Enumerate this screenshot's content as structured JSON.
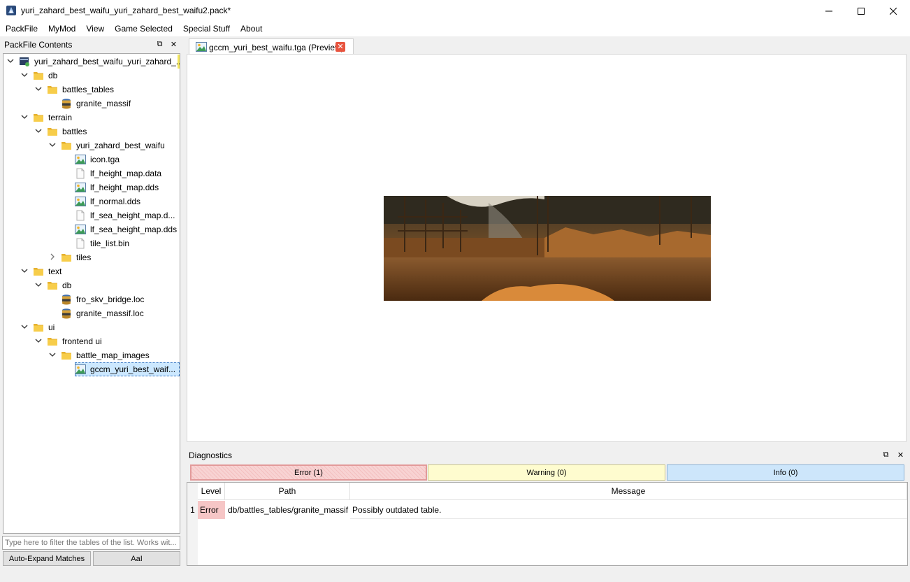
{
  "window": {
    "title": "yuri_zahard_best_waifu_yuri_zahard_best_waifu2.pack*",
    "minimize_glyph": "—",
    "maximize_glyph": "☐",
    "close_glyph": "✕"
  },
  "menu": [
    "PackFile",
    "MyMod",
    "View",
    "Game Selected",
    "Special Stuff",
    "About"
  ],
  "left_panel": {
    "title": "PackFile Contents",
    "float_glyph": "⧉",
    "close_glyph": "✕",
    "tree": [
      {
        "label": "yuri_zahard_best_waifu_yuri_zahard_...",
        "icon": "pack-icon",
        "expanded": true
      },
      {
        "label": "db",
        "icon": "folder-icon",
        "expanded": true
      },
      {
        "label": "battles_tables",
        "icon": "folder-icon",
        "expanded": true
      },
      {
        "label": "granite_massif",
        "icon": "database-icon"
      },
      {
        "label": "terrain",
        "icon": "folder-icon",
        "expanded": true
      },
      {
        "label": "battles",
        "icon": "folder-icon",
        "expanded": true
      },
      {
        "label": "yuri_zahard_best_waifu",
        "icon": "folder-icon",
        "expanded": true
      },
      {
        "label": "icon.tga",
        "icon": "image-icon"
      },
      {
        "label": "lf_height_map.data",
        "icon": "file-icon"
      },
      {
        "label": "lf_height_map.dds",
        "icon": "image-icon"
      },
      {
        "label": "lf_normal.dds",
        "icon": "image-icon"
      },
      {
        "label": "lf_sea_height_map.d...",
        "icon": "file-icon"
      },
      {
        "label": "lf_sea_height_map.dds",
        "icon": "image-icon"
      },
      {
        "label": "tile_list.bin",
        "icon": "file-icon"
      },
      {
        "label": "tiles",
        "icon": "folder-icon",
        "expanded": false
      },
      {
        "label": "text",
        "icon": "folder-icon",
        "expanded": true
      },
      {
        "label": "db",
        "icon": "folder-icon",
        "expanded": true
      },
      {
        "label": "fro_skv_bridge.loc",
        "icon": "database-icon"
      },
      {
        "label": "granite_massif.loc",
        "icon": "database-icon"
      },
      {
        "label": "ui",
        "icon": "folder-icon",
        "expanded": true
      },
      {
        "label": "frontend ui",
        "icon": "folder-icon",
        "expanded": true
      },
      {
        "label": "battle_map_images",
        "icon": "folder-icon",
        "expanded": true
      },
      {
        "label": "gccm_yuri_best_waif...",
        "icon": "image-icon",
        "selected": true
      }
    ],
    "filter_placeholder": "Type here to filter the tables of the list. Works wit...",
    "auto_expand_label": "Auto-Expand Matches",
    "case_label": "AaI"
  },
  "editor": {
    "tab_label": "gccm_yuri_best_waifu.tga (Preview)",
    "tab_close_glyph": "✕"
  },
  "diagnostics": {
    "title": "Diagnostics",
    "float_glyph": "⧉",
    "close_glyph": "✕",
    "tabs": {
      "error": "Error (1)",
      "warning": "Warning (0)",
      "info": "Info (0)"
    },
    "columns": [
      "Level",
      "Path",
      "Message"
    ],
    "rows": [
      {
        "num": "1",
        "level": "Error",
        "path": "db/battles_tables/granite_massif",
        "message": "Possibly outdated table."
      }
    ]
  },
  "colors": {
    "folder": "#f5c242",
    "selection": "#cce8ff",
    "error_tab": "#f8d3d3",
    "warning_tab": "#fefccf",
    "info_tab": "#cde6fb",
    "error_cell": "#f6c6c6"
  }
}
